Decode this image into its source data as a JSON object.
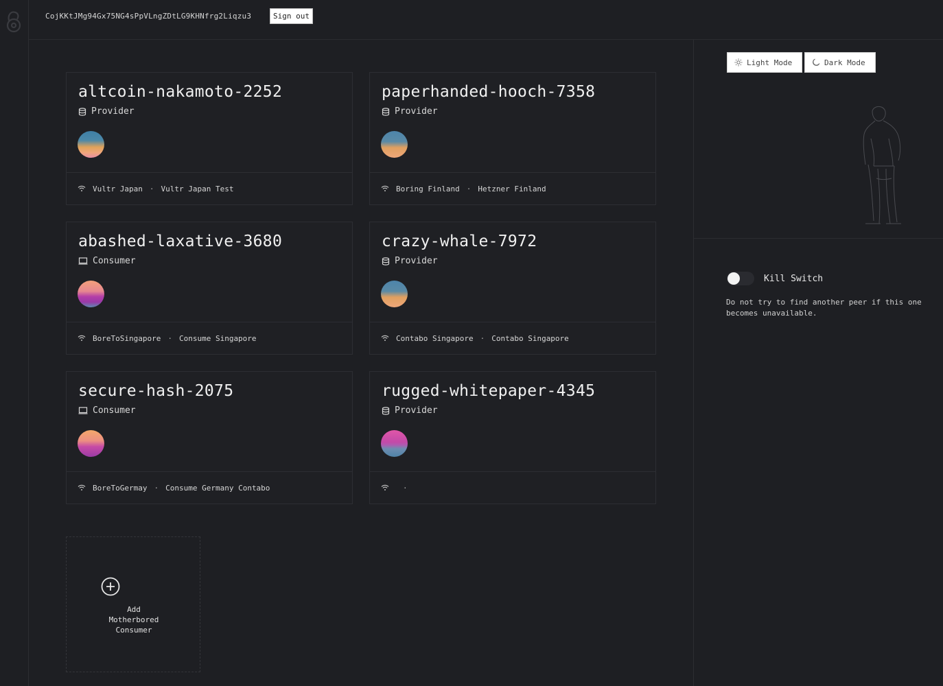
{
  "header": {
    "key": "CojKKtJMg94Gx75NG4sPpVLngZDtLG9KHNfrg2Liqzu3",
    "sign_out": "Sign out"
  },
  "theme": {
    "light_label": "Light Mode",
    "dark_label": "Dark Mode"
  },
  "kill_switch": {
    "label": "Kill Switch",
    "description": "Do not try to find another peer if this one becomes unavailable.",
    "enabled": false
  },
  "cards": [
    {
      "name": "altcoin-nakamoto-2252",
      "role": "Provider",
      "icon": "database-icon",
      "left": "Vultr Japan",
      "right": "Vultr Japan Test"
    },
    {
      "name": "paperhanded-hooch-7358",
      "role": "Provider",
      "icon": "database-icon",
      "left": "Boring Finland",
      "right": "Hetzner Finland"
    },
    {
      "name": "abashed-laxative-3680",
      "role": "Consumer",
      "icon": "laptop-icon",
      "left": "BoreToSingapore",
      "right": "Consume Singapore"
    },
    {
      "name": "crazy-whale-7972",
      "role": "Provider",
      "icon": "database-icon",
      "left": "Contabo Singapore",
      "right": "Contabo Singapore"
    },
    {
      "name": "secure-hash-2075",
      "role": "Consumer",
      "icon": "laptop-icon",
      "left": "BoreToGermay",
      "right": "Consume Germany Contabo"
    },
    {
      "name": "rugged-whitepaper-4345",
      "role": "Provider",
      "icon": "database-icon",
      "left": "",
      "right": ""
    }
  ],
  "add_card": {
    "line1": "Add",
    "line2": "Motherbored",
    "line3": "Consumer"
  },
  "separator": "·"
}
